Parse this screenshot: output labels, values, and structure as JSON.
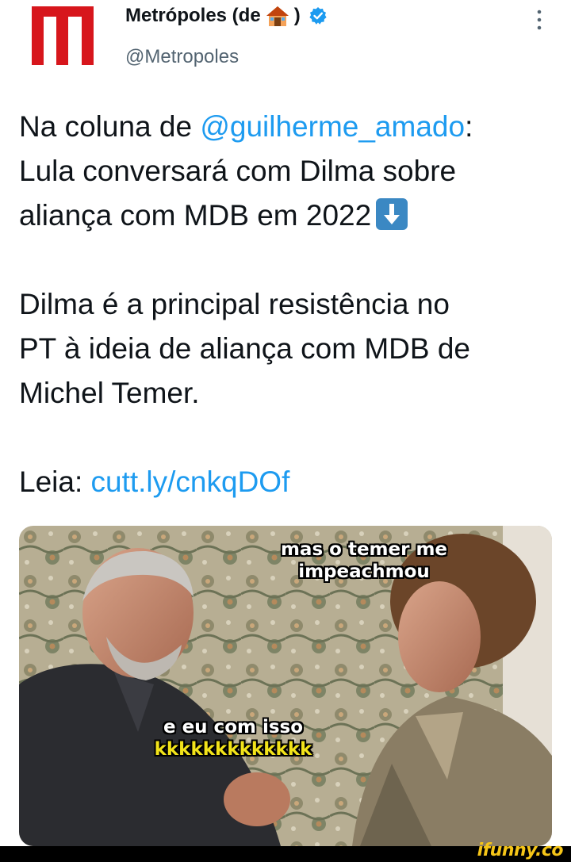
{
  "account": {
    "name": "Metrópoles (de",
    "name_close": ")",
    "handle": "@Metropoles"
  },
  "tweet": {
    "line1_prefix": "Na coluna de ",
    "mention": "@guilherme_amado",
    "line1_suffix": ":",
    "line2": "Lula conversará com Dilma sobre",
    "line3": "aliança com MDB em 2022",
    "para2_line1": "Dilma é a principal resistência no",
    "para2_line2": "PT à ideia de aliança com MDB de",
    "para2_line3": "Michel Temer.",
    "read_prefix": "Leia: ",
    "read_link": "cutt.ly/cnkqDOf"
  },
  "meme": {
    "top_caption_line1": "mas o temer me",
    "top_caption_line2": "impeachmou",
    "bottom_caption_line1": "e eu com isso",
    "bottom_caption_line2": "kkkkkkkkkkkkk"
  },
  "watermark": "ifunny.co",
  "icons": {
    "logo": "metropoles-logo",
    "house": "house-emoji-icon",
    "verified": "verified-badge-icon",
    "more": "more-options-icon",
    "arrow": "down-arrow-emoji-icon"
  },
  "colors": {
    "brand_red": "#d7161c",
    "link_blue": "#1d9bf0",
    "text": "#0f1419",
    "muted": "#536471"
  }
}
